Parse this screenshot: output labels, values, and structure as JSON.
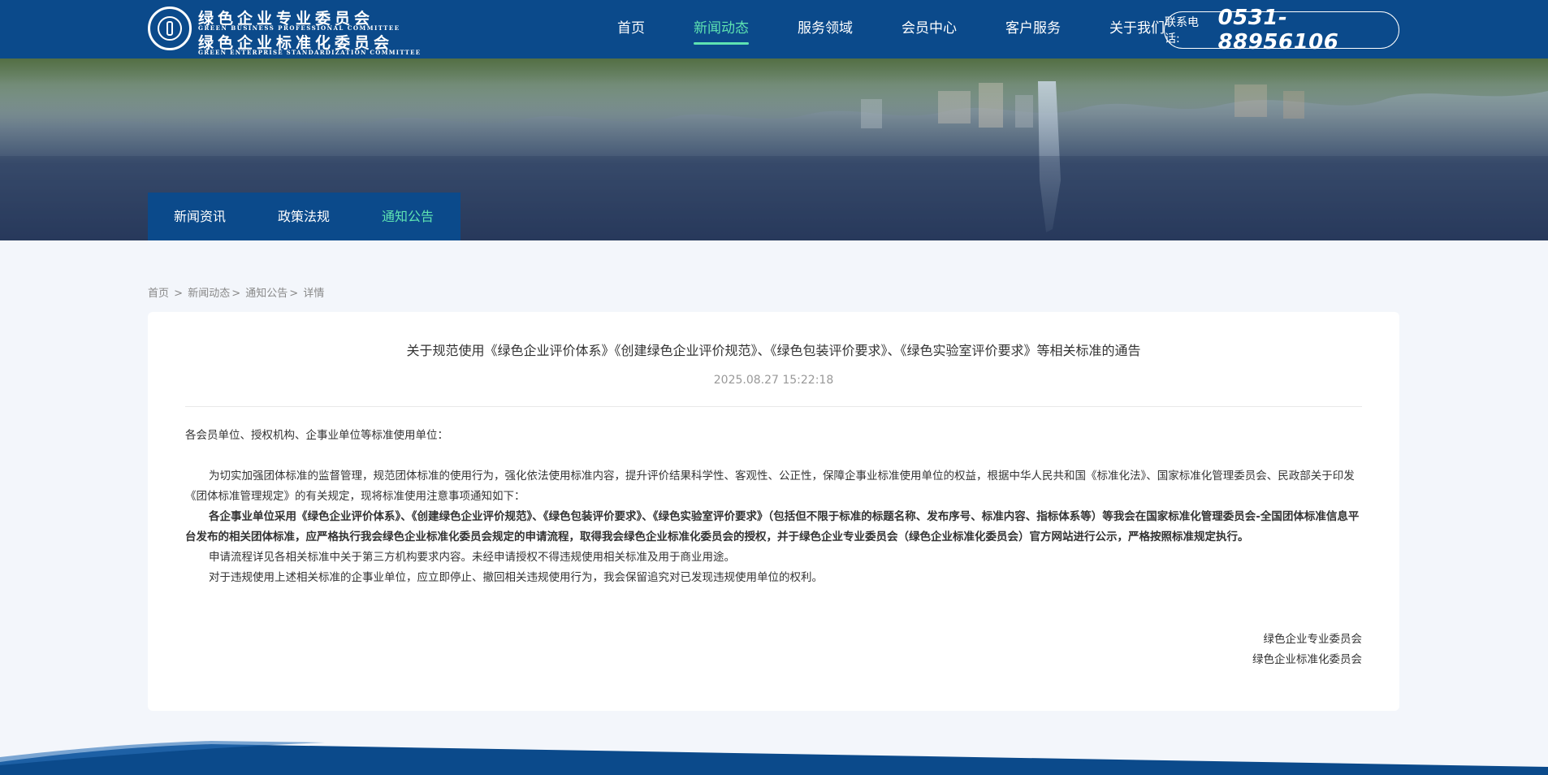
{
  "header": {
    "logo": {
      "cn_line1": "绿色企业专业委员会",
      "en_line1": "GREEN BUSINESS PROFESSIONAL COMMITTEE",
      "cn_line2": "绿色企业标准化委员会",
      "en_line2": "GREEN ENTERPRISE STANDARDIZATION COMMITTEE"
    },
    "nav": [
      {
        "label": "首页",
        "active": false
      },
      {
        "label": "新闻动态",
        "active": true
      },
      {
        "label": "服务领域",
        "active": false
      },
      {
        "label": "会员中心",
        "active": false
      },
      {
        "label": "客户服务",
        "active": false
      },
      {
        "label": "关于我们",
        "active": false
      }
    ],
    "phone": {
      "label": "联系电话:",
      "number": "0531-88956106"
    }
  },
  "subnav": [
    {
      "label": "新闻资讯",
      "active": false
    },
    {
      "label": "政策法规",
      "active": false
    },
    {
      "label": "通知公告",
      "active": true
    }
  ],
  "breadcrumb": [
    "首页",
    "新闻动态",
    "通知公告",
    "详情"
  ],
  "article": {
    "title": "关于规范使用《绿色企业评价体系》《创建绿色企业评价规范》、《绿色包装评价要求》、《绿色实验室评价要求》等相关标准的通告",
    "date": "2025.08.27 15:22:18",
    "greeting": "各会员单位、授权机构、企事业单位等标准使用单位：",
    "paragraphs": [
      {
        "text": "为切实加强团体标准的监督管理，规范团体标准的使用行为，强化依法使用标准内容，提升评价结果科学性、客观性、公正性，保障企事业标准使用单位的权益，根据中华人民共和国《标准化法》、国家标准化管理委员会、民政部关于印发《团体标准管理规定》的有关规定，现将标准使用注意事项通知如下：",
        "bold": false
      },
      {
        "text": "各企事业单位采用《绿色企业评价体系》、《创建绿色企业评价规范》、《绿色包装评价要求》、《绿色实验室评价要求》（包括但不限于标准的标题名称、发布序号、标准内容、指标体系等）等我会在国家标准化管理委员会-全国团体标准信息平台发布的相关团体标准，应严格执行我会绿色企业标准化委员会规定的申请流程，取得我会绿色企业标准化委员会的授权，并于绿色企业专业委员会（绿色企业标准化委员会）官方网站进行公示，严格按照标准规定执行。",
        "bold": true
      },
      {
        "text": "申请流程详见各相关标准中关于第三方机构要求内容。未经申请授权不得违规使用相关标准及用于商业用途。",
        "bold": false
      },
      {
        "text": "对于违规使用上述相关标准的企事业单位，应立即停止、撤回相关违规使用行为，我会保留追究对已发现违规使用单位的权利。",
        "bold": false
      }
    ],
    "signature": [
      "绿色企业专业委员会",
      "绿色企业标准化委员会"
    ]
  },
  "colors": {
    "primary": "#0b4a8b",
    "accent": "#5ee3b2",
    "page_bg": "#f3f6fb"
  }
}
